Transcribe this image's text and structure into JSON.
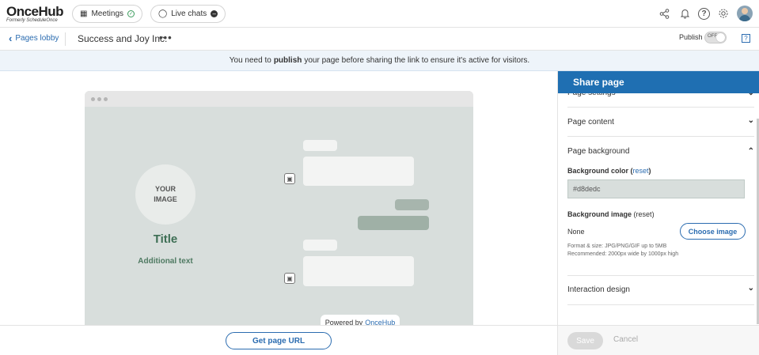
{
  "header": {
    "brand": "OnceHub",
    "brand_sub": "Formerly ScheduleOnce",
    "meetings_label": "Meetings",
    "live_chats_label": "Live chats"
  },
  "subheader": {
    "back_label": "Pages lobby",
    "page_name": "Success and Joy Inc.",
    "more_label": "•••",
    "publish_label": "Publish",
    "toggle_state": "OFF",
    "help_label": "?"
  },
  "notice": {
    "before": "You need to",
    "bold": "publish",
    "after": "your page before sharing the link to ensure it's active for visitors."
  },
  "preview": {
    "image_line1": "YOUR",
    "image_line2": "IMAGE",
    "title": "Title",
    "subtitle": "Additional text",
    "powered_by": "Powered by",
    "powered_brand": "OnceHub"
  },
  "panel": {
    "title": "Share page",
    "sections": {
      "page_settings": "Page settings",
      "page_content": "Page content",
      "page_background": "Page background",
      "interaction_design": "Interaction design"
    },
    "background_color_label": "Background color",
    "background_color_reset": "reset",
    "background_color_value": "#d8dedc",
    "background_image_label": "Background image",
    "background_image_reset": "reset",
    "background_image_value": "None",
    "choose_image_label": "Choose image",
    "hint_line1": "Format & size: JPG/PNG/GIF up to 5MB",
    "hint_line2": "Recommended: 2000px wide by 1000px high"
  },
  "footer": {
    "get_url_label": "Get page URL",
    "save_label": "Save",
    "cancel_label": "Cancel"
  },
  "colors": {
    "accent": "#1f6fb2",
    "preview_bg": "#d8dedc",
    "title_green": "#3d6e54"
  }
}
